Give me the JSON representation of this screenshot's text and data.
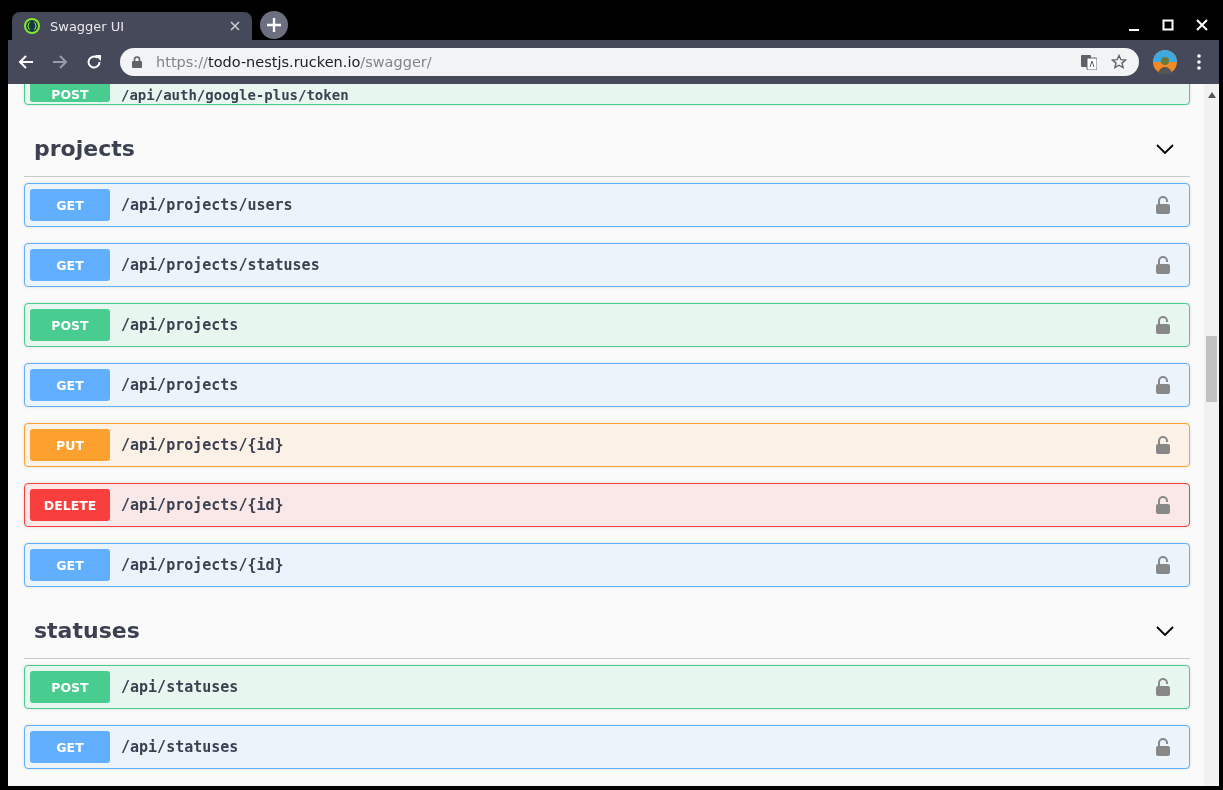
{
  "tabs": [
    {
      "title": "Swagger UI",
      "selected": true
    }
  ],
  "address": {
    "scheme": "https://",
    "host": "todo-nestjs.rucken.io",
    "path": "/swagger/",
    "secure": true
  },
  "partial_operation": {
    "kind": "post",
    "method": "POST",
    "path": "/api/auth/google-plus/token"
  },
  "sections": [
    {
      "name": "projects",
      "expanded": true,
      "operations": [
        {
          "kind": "get",
          "method": "GET",
          "path": "/api/projects/users",
          "locked": false
        },
        {
          "kind": "get",
          "method": "GET",
          "path": "/api/projects/statuses",
          "locked": false
        },
        {
          "kind": "post",
          "method": "POST",
          "path": "/api/projects",
          "locked": false
        },
        {
          "kind": "get",
          "method": "GET",
          "path": "/api/projects",
          "locked": false
        },
        {
          "kind": "put",
          "method": "PUT",
          "path": "/api/projects/{id}",
          "locked": false
        },
        {
          "kind": "delete",
          "method": "DELETE",
          "path": "/api/projects/{id}",
          "locked": false
        },
        {
          "kind": "get",
          "method": "GET",
          "path": "/api/projects/{id}",
          "locked": false
        }
      ]
    },
    {
      "name": "statuses",
      "expanded": true,
      "operations": [
        {
          "kind": "post",
          "method": "POST",
          "path": "/api/statuses",
          "locked": false
        },
        {
          "kind": "get",
          "method": "GET",
          "path": "/api/statuses",
          "locked": false
        }
      ]
    }
  ]
}
